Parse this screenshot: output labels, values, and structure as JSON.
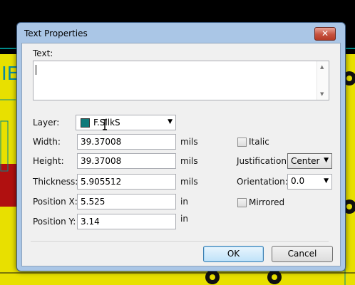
{
  "window": {
    "title": "Text Properties",
    "close_label": "✕"
  },
  "text_field": {
    "label": "Text:",
    "value": ""
  },
  "layer": {
    "label": "Layer:",
    "value": "F.SilkS",
    "swatch_color": "#0f7a7a"
  },
  "width": {
    "label": "Width:",
    "value": "39.37008",
    "unit": "mils"
  },
  "height": {
    "label": "Height:",
    "value": "39.37008",
    "unit": "mils"
  },
  "thickness": {
    "label": "Thickness:",
    "value": "5.905512",
    "unit": "mils"
  },
  "position_x": {
    "label": "Position X:",
    "value": "5.525",
    "unit": "in"
  },
  "position_y": {
    "label": "Position Y:",
    "value": "3.14",
    "unit": "in"
  },
  "italic": {
    "label": "Italic",
    "checked": false
  },
  "justification": {
    "label": "Justification:",
    "value": "Center"
  },
  "orientation": {
    "label": "Orientation:",
    "value": "0.0"
  },
  "mirrored": {
    "label": "Mirrored",
    "checked": false
  },
  "buttons": {
    "ok": "OK",
    "cancel": "Cancel"
  },
  "colors": {
    "pcb_yellow": "#e8e000",
    "pcb_red": "#b01010",
    "trace": "#008a8a",
    "dialog_frame": "#aac6e6"
  }
}
